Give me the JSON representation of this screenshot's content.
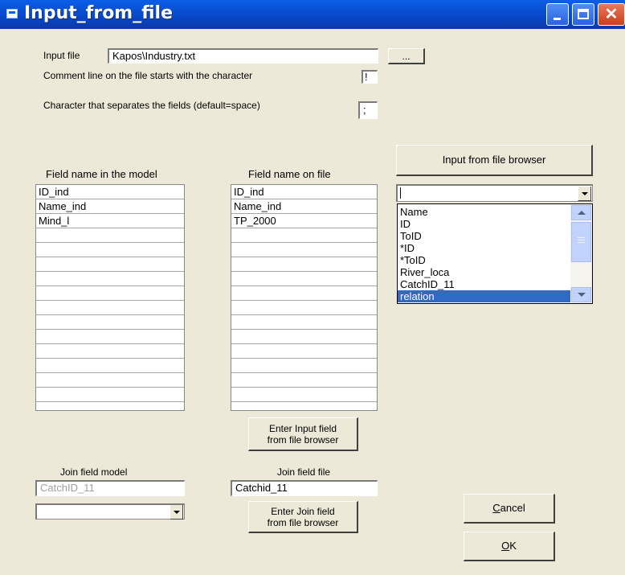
{
  "window": {
    "title": "Input_from_file"
  },
  "input_file": {
    "label": "Input file",
    "value": "Kapos\\Industry.txt",
    "browse_label": "..."
  },
  "comment": {
    "label": "Comment line on the file starts with the character",
    "value": "!"
  },
  "separator": {
    "label": "Character that separates the fields (default=space)",
    "value": ";"
  },
  "browser_button": {
    "label": "Input from file browser"
  },
  "browser_combo": {
    "value": ""
  },
  "browser_list": {
    "items": [
      "Name",
      "ID",
      "ToID",
      "*ID",
      "*ToID",
      "River_loca",
      "CatchID_11",
      "relation"
    ],
    "selected_index": 7
  },
  "model_fields": {
    "header": "Field name in the model",
    "rows": [
      "ID_ind",
      "Name_ind",
      "Mind_l",
      "",
      "",
      "",
      "",
      "",
      "",
      "",
      "",
      "",
      "",
      "",
      ""
    ]
  },
  "file_fields": {
    "header": "Field name on  file",
    "rows": [
      "ID_ind",
      "Name_ind",
      "TP_2000",
      "",
      "",
      "",
      "",
      "",
      "",
      "",
      "",
      "",
      "",
      "",
      ""
    ]
  },
  "enter_input_button": {
    "line1": "Enter Input field",
    "line2": "from file browser"
  },
  "join_model": {
    "label": "Join field model",
    "value": "CatchID_11",
    "combo_value": ""
  },
  "join_file": {
    "label": "Join field file",
    "value": "Catchid_11"
  },
  "enter_join_button": {
    "line1": "Enter Join field",
    "line2": "from file browser"
  },
  "cancel_button": {
    "label": "Cancel",
    "mnemonic": "C",
    "rest": "ancel"
  },
  "ok_button": {
    "label": "OK",
    "mnemonic": "O",
    "rest": "K"
  },
  "colors": {
    "titlebar": "#0a5fe6",
    "dialog_bg": "#ece9d8",
    "selection": "#316ac5"
  }
}
